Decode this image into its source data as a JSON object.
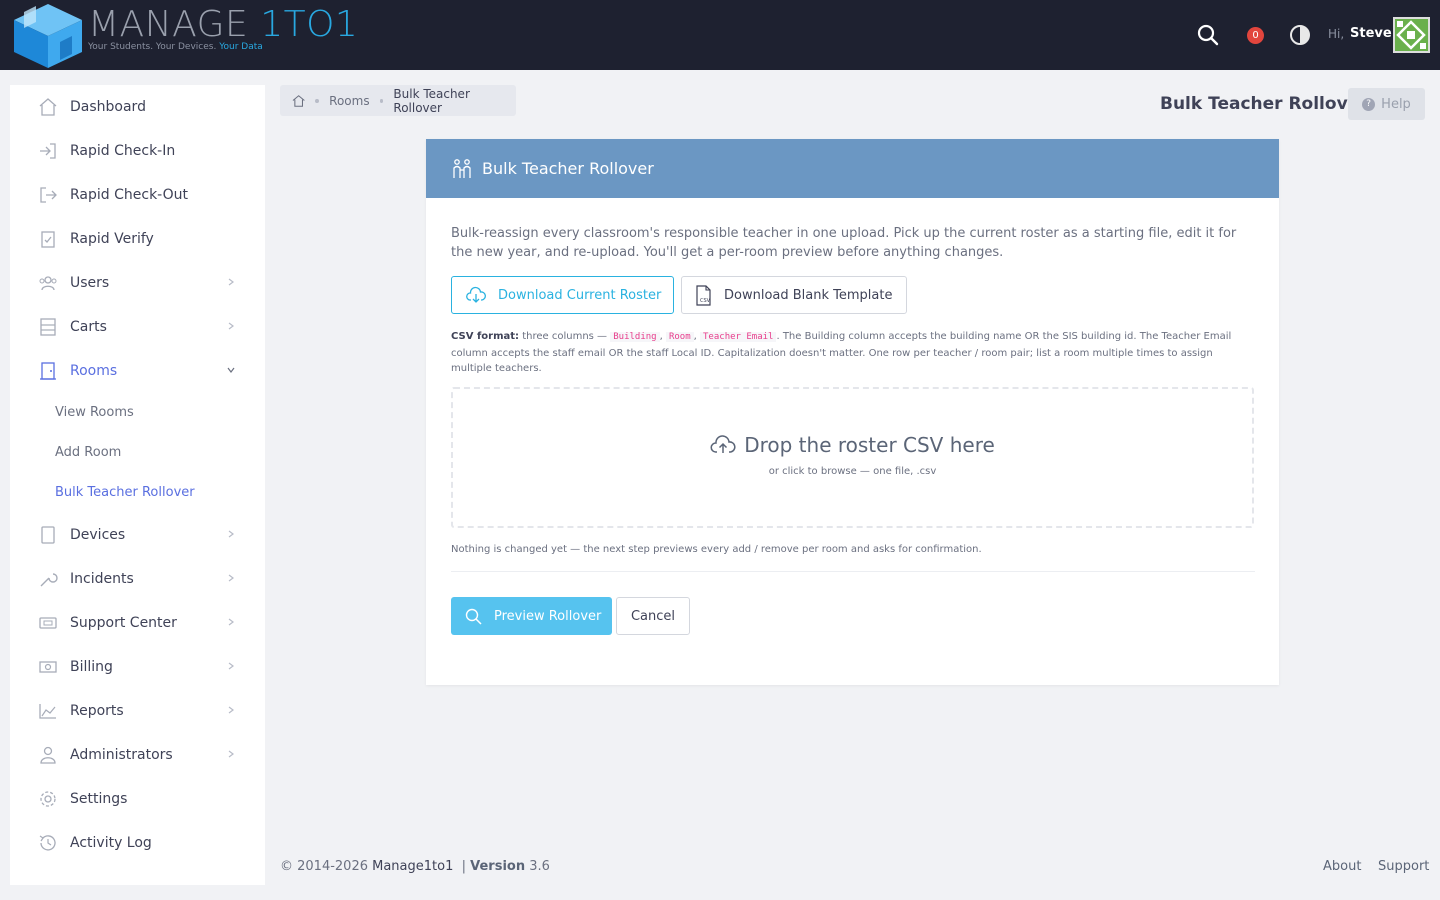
{
  "header": {
    "logo_text_main": "MANAGE ",
    "logo_text_accent": "1TO1",
    "logo_tagline": "Your Students. Your Devices. ",
    "logo_tagline_accent": "Your Data",
    "notification_count": "0",
    "greeting": "Hi,",
    "user_name": "Steve"
  },
  "sidebar": {
    "items": [
      {
        "label": "Dashboard",
        "icon": "home-icon"
      },
      {
        "label": "Rapid Check-In",
        "icon": "sign-in-icon"
      },
      {
        "label": "Rapid Check-Out",
        "icon": "sign-out-icon"
      },
      {
        "label": "Rapid Verify",
        "icon": "clipboard-check-icon"
      },
      {
        "label": "Users",
        "icon": "users-icon"
      },
      {
        "label": "Carts",
        "icon": "cart-icon"
      },
      {
        "label": "Rooms",
        "icon": "door-icon"
      },
      {
        "label": "Devices",
        "icon": "tablet-icon"
      },
      {
        "label": "Incidents",
        "icon": "wrench-icon"
      },
      {
        "label": "Support Center",
        "icon": "ticket-icon"
      },
      {
        "label": "Billing",
        "icon": "money-icon"
      },
      {
        "label": "Reports",
        "icon": "chart-icon"
      },
      {
        "label": "Administrators",
        "icon": "admin-icon"
      },
      {
        "label": "Settings",
        "icon": "gear-icon"
      },
      {
        "label": "Activity Log",
        "icon": "history-icon"
      }
    ],
    "rooms_sub": [
      {
        "label": "View Rooms"
      },
      {
        "label": "Add Room"
      },
      {
        "label": "Bulk Teacher Rollover"
      }
    ]
  },
  "breadcrumb": {
    "rooms": "Rooms",
    "current": "Bulk Teacher Rollover"
  },
  "page": {
    "title": "Bulk Teacher Rollover",
    "help_label": "Help"
  },
  "card": {
    "title": "Bulk Teacher Rollover",
    "intro": "Bulk-reassign every classroom's responsible teacher in one upload. Pick up the current roster as a starting file, edit it for the new year, and re-upload. You'll get a per-room preview before anything changes.",
    "download_current": "Download Current Roster",
    "download_blank": "Download Blank Template",
    "csv_format_label": "CSV format:",
    "csv_format_prefix": " three columns — ",
    "csv_col_building": "Building",
    "csv_col_room": "Room",
    "csv_col_email": "Teacher Email",
    "csv_format_rest": ". The Building column accepts the building name OR the SIS building id. The Teacher Email column accepts the staff email OR the staff Local ID. Capitalization doesn't matter. One row per teacher / room pair; list a room multiple times to assign multiple teachers.",
    "dropzone_title": "Drop the roster CSV here",
    "dropzone_sub": "or click to browse — one file, .csv",
    "note": "Nothing is changed yet — the next step previews every add / remove per room and asks for confirmation.",
    "preview_button": "Preview Rollover",
    "cancel_button": "Cancel"
  },
  "footer": {
    "copyright": "© 2014-2026 ",
    "brand": "Manage1to1",
    "version_label": "Version",
    "version": "3.6",
    "about": "About",
    "support": "Support"
  }
}
